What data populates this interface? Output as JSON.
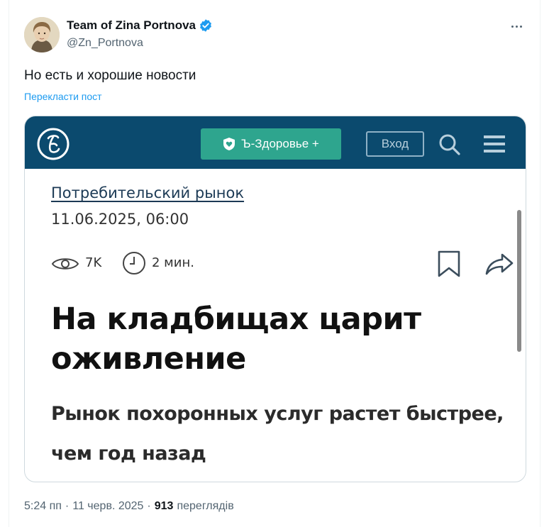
{
  "author": {
    "display_name": "Team of Zina Portnova",
    "handle": "@Zn_Portnova",
    "verified": true,
    "avatar_icon": "portrait-avatar"
  },
  "tweet": {
    "text": "Но есть и хорошие новости",
    "translate_label": "Перекласти пост"
  },
  "media": {
    "site": {
      "logo_icon": "kommersant-logo",
      "health_button": "Ъ-Здоровье +",
      "login_button": "Вход",
      "header_color": "#0b4a6e",
      "button_color": "#2ea58e"
    },
    "article": {
      "category": "Потребительский рынок",
      "date": "11.06.2025, 06:00",
      "views": "7K",
      "read_time": "2 мин.",
      "headline": "На кладбищах царит оживление",
      "subheadline": "Рынок похоронных услуг растет быстрее, чем год назад"
    }
  },
  "footer": {
    "time": "5:24 пп",
    "separator": "·",
    "date": "11 черв. 2025",
    "views_count": "913",
    "views_label": "переглядів"
  },
  "colors": {
    "accent": "#1d9bf0",
    "secondary_text": "#536471"
  }
}
